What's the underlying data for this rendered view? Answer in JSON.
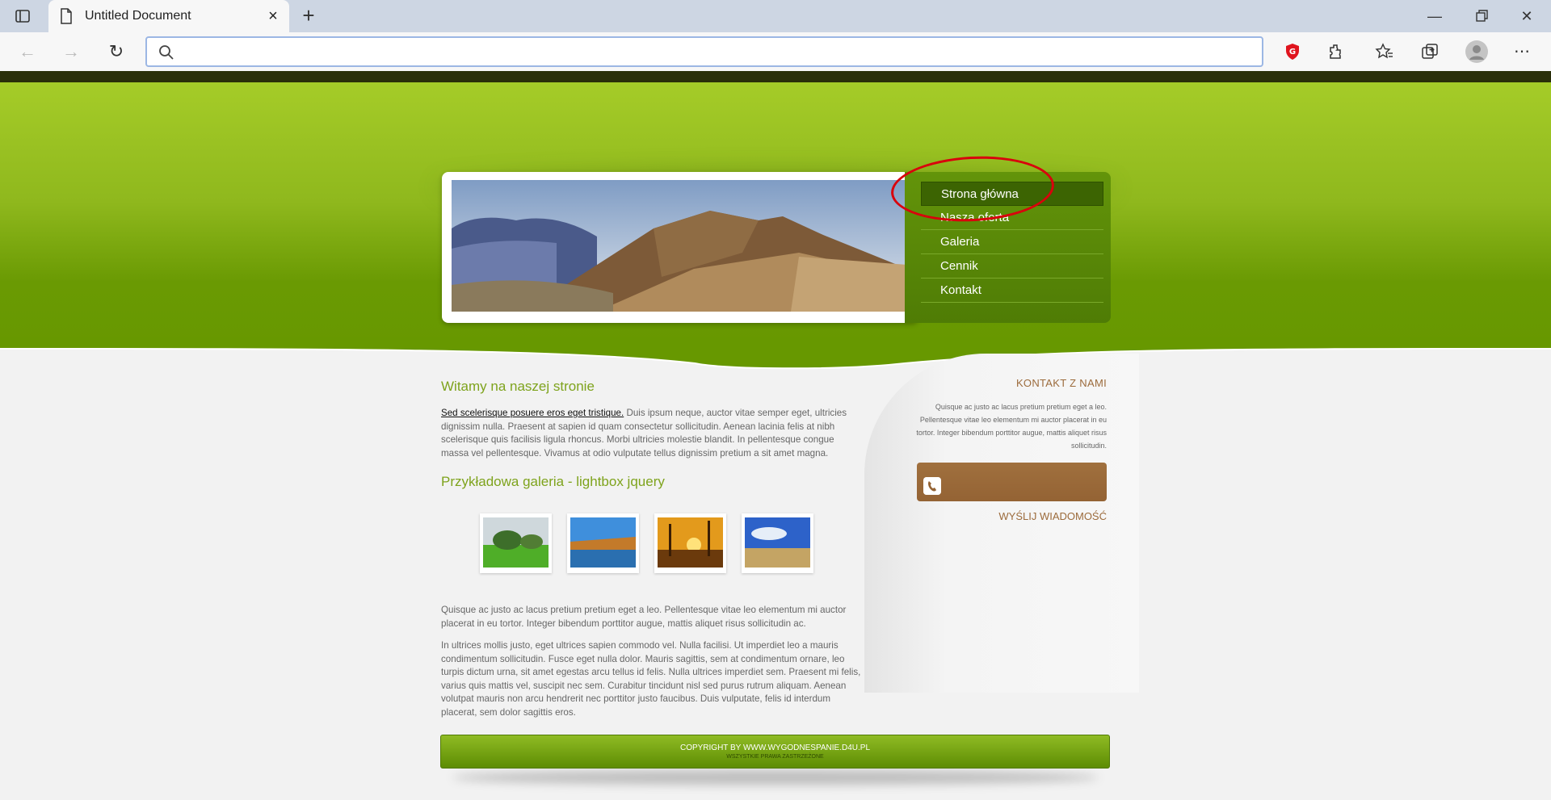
{
  "browser": {
    "tab_title": "Untitled Document",
    "new_tab": "+",
    "address_value": ""
  },
  "menu": {
    "items": [
      {
        "label": "Strona główna",
        "active": true
      },
      {
        "label": "Nasza oferta"
      },
      {
        "label": "Galeria"
      },
      {
        "label": "Cennik"
      },
      {
        "label": "Kontakt"
      }
    ]
  },
  "content": {
    "welcome_heading": "Witamy na naszej stronie",
    "intro_link": "Sed scelerisque posuere eros eget tristique.",
    "intro_text": " Duis ipsum neque, auctor vitae semper eget, ultricies dignissim nulla. Praesent at sapien id quam consectetur sollicitudin. Aenean lacinia felis at nibh scelerisque quis facilisis ligula rhoncus. Morbi ultricies molestie blandit. In pellentesque congue massa vel pellentesque. Vivamus at odio vulputate tellus dignissim pretium a sit amet magna.",
    "gallery_heading": "Przykładowa galeria - lightbox jquery",
    "para2": "Quisque ac justo ac lacus pretium pretium eget a leo. Pellentesque vitae leo elementum mi auctor placerat in eu tortor. Integer bibendum porttitor augue, mattis aliquet risus sollicitudin ac.",
    "para3": "In ultrices mollis justo, eget ultrices sapien commodo vel. Nulla facilisi. Ut imperdiet leo a mauris condimentum sollicitudin. Fusce eget nulla dolor. Mauris sagittis, sem at condimentum ornare, leo turpis dictum urna, sit amet egestas arcu tellus id felis. Nulla ultrices imperdiet sem. Praesent mi felis, varius quis mattis vel, suscipit nec sem. Curabitur tincidunt nisl sed purus rutrum aliquam. Aenean volutpat mauris non arcu hendrerit nec porttitor justo faucibus. Duis vulputate, felis id interdum placerat, sem dolor sagittis eros."
  },
  "sidebar": {
    "title": "KONTAKT Z NAMI",
    "text": "Quisque ac justo ac lacus pretium pretium eget a leo. Pellentesque vitae leo elementum mi auctor placerat in eu tortor. Integer bibendum porttitor augue, mattis aliquet risus sollicitudin.",
    "send_link": "WYŚLIJ WIADOMOŚĆ"
  },
  "footer": {
    "copyright": "COPYRIGHT BY WWW.WYGODNESPANIE.D4U.PL",
    "rights": "WSZYSTKIE PRAWA ZASTRZEŻONE"
  },
  "colors": {
    "accent_green": "#7ea31c",
    "brown": "#9c6b3c",
    "highlight_red": "#d9000c"
  }
}
